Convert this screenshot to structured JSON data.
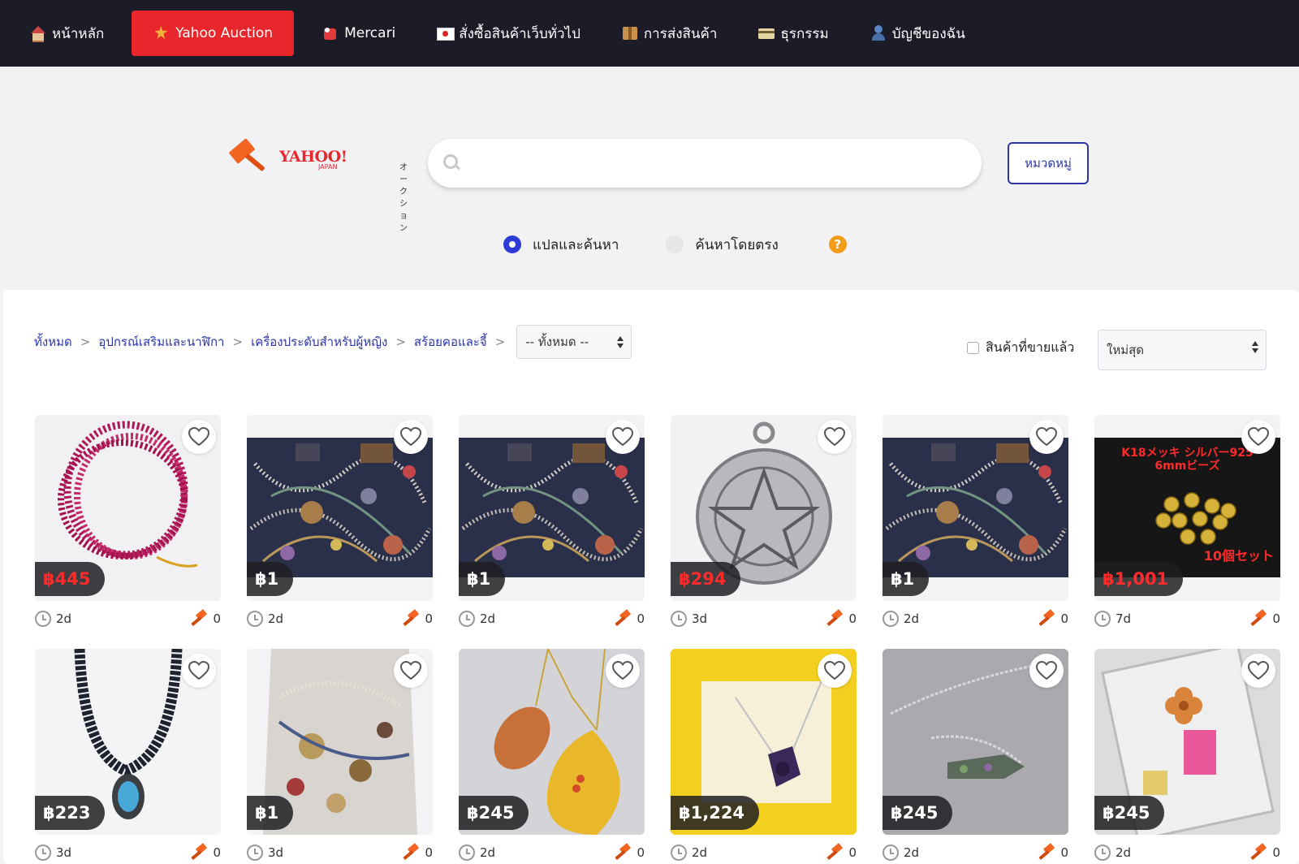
{
  "nav": {
    "items": [
      {
        "label": "หน้าหลัก",
        "icon": "home-icon"
      },
      {
        "label": "Yahoo Auction",
        "icon": "auction-star-icon",
        "active": true
      },
      {
        "label": "Mercari",
        "icon": "mercari-icon"
      },
      {
        "label": "สั่งซื้อสินค้าเว็บทั่วไป",
        "icon": "japan-flag-icon"
      },
      {
        "label": "การส่งสินค้า",
        "icon": "package-icon"
      },
      {
        "label": "ธุรกรรม",
        "icon": "credit-card-icon"
      },
      {
        "label": "บัญชีของฉัน",
        "icon": "user-icon"
      }
    ]
  },
  "logo": {
    "yahoo": "YAHOO!",
    "japan": "JAPAN",
    "katakana": "オークション"
  },
  "search": {
    "value": "",
    "placeholder": ""
  },
  "category_button": "หมวดหมู่",
  "search_mode": {
    "options": [
      {
        "label": "แปลและค้นหา",
        "selected": true
      },
      {
        "label": "ค้นหาโดยตรง",
        "selected": false
      }
    ],
    "help": "?"
  },
  "breadcrumb": {
    "items": [
      "ทั้งหมด",
      "อุปกรณ์เสริมและนาฬิกา",
      "เครื่องประดับสำหรับผู้หญิง",
      "สร้อยคอและจี้"
    ],
    "separator": ">",
    "subcategory_select": "-- ทั้งหมด --"
  },
  "filters": {
    "sold_label": "สินค้าที่ขายแล้ว",
    "sold_checked": false,
    "sort": "ใหม่สุด"
  },
  "colors": {
    "accent": "#e8262b",
    "nav_bg": "#1c1b28",
    "link": "#2b35a8",
    "price_red": "#ff2a2a"
  },
  "products": [
    {
      "price": "฿445",
      "price_red": true,
      "time": "2d",
      "bids": "0",
      "art": "pink-bead-necklace"
    },
    {
      "price": "฿1",
      "price_red": false,
      "time": "2d",
      "bids": "0",
      "art": "jewelry-pile"
    },
    {
      "price": "฿1",
      "price_red": false,
      "time": "2d",
      "bids": "0",
      "art": "jewelry-pile"
    },
    {
      "price": "฿294",
      "price_red": true,
      "time": "3d",
      "bids": "0",
      "art": "silver-pentagram-pendant"
    },
    {
      "price": "฿1",
      "price_red": false,
      "time": "2d",
      "bids": "0",
      "art": "jewelry-pile"
    },
    {
      "price": "฿1,001",
      "price_red": true,
      "time": "7d",
      "bids": "0",
      "art": "gold-beads",
      "overlay_text_top": "K18メッキ シルバー925",
      "overlay_text_sub": "6mmビーズ",
      "overlay_text_bottom": "10個セット"
    },
    {
      "price": "฿223",
      "price_red": false,
      "time": "3d",
      "bids": "0",
      "art": "pearl-necklace-turquoise"
    },
    {
      "price": "฿1",
      "price_red": false,
      "time": "3d",
      "bids": "0",
      "art": "jewelry-bag"
    },
    {
      "price": "฿245",
      "price_red": false,
      "time": "2d",
      "bids": "0",
      "art": "agate-gold-leaf"
    },
    {
      "price": "฿1,224",
      "price_red": false,
      "time": "2d",
      "bids": "0",
      "art": "pendant-yellow-box"
    },
    {
      "price": "฿245",
      "price_red": false,
      "time": "2d",
      "bids": "0",
      "art": "fish-pendant-chain"
    },
    {
      "price": "฿245",
      "price_red": false,
      "time": "2d",
      "bids": "0",
      "art": "flower-in-acrylic"
    }
  ]
}
